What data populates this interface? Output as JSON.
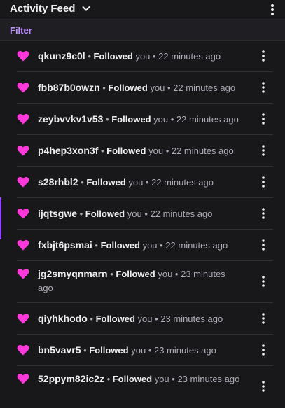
{
  "header": {
    "title": "Activity Feed",
    "icons": {
      "chevron": "chevron-down-icon",
      "menu": "more-vertical-icon"
    }
  },
  "filter": {
    "label": "Filter"
  },
  "colors": {
    "background": "#18181b",
    "heart": "#ff38db",
    "accent": "#bf94ff",
    "text": "#efeff1",
    "muted": "#adadb8"
  },
  "items": [
    {
      "username": "qkunz9c0l",
      "action": "Followed",
      "suffix": "you",
      "time": "22 minutes ago"
    },
    {
      "username": "fbb87b0owzn",
      "action": "Followed",
      "suffix": "you",
      "time": "22 minutes ago"
    },
    {
      "username": "zeybvvkv1v53",
      "action": "Followed",
      "suffix": "you",
      "time": "22 minutes ago"
    },
    {
      "username": "p4hep3xon3f",
      "action": "Followed",
      "suffix": "you",
      "time": "22 minutes ago"
    },
    {
      "username": "s28rhbl2",
      "action": "Followed",
      "suffix": "you",
      "time": "22 minutes ago"
    },
    {
      "username": "ijqtsgwe",
      "action": "Followed",
      "suffix": "you",
      "time": "22 minutes ago"
    },
    {
      "username": "fxbjt6psmai",
      "action": "Followed",
      "suffix": "you",
      "time": "22 minutes ago"
    },
    {
      "username": "jg2smyqnmarn",
      "action": "Followed",
      "suffix": "you",
      "time": "23 minutes ago"
    },
    {
      "username": "qiyhkhodo",
      "action": "Followed",
      "suffix": "you",
      "time": "23 minutes ago"
    },
    {
      "username": "bn5vavr5",
      "action": "Followed",
      "suffix": "you",
      "time": "23 minutes ago"
    },
    {
      "username": "52ppym82ic2z",
      "action": "Followed",
      "suffix": "you",
      "time": "23 minutes ago"
    }
  ]
}
